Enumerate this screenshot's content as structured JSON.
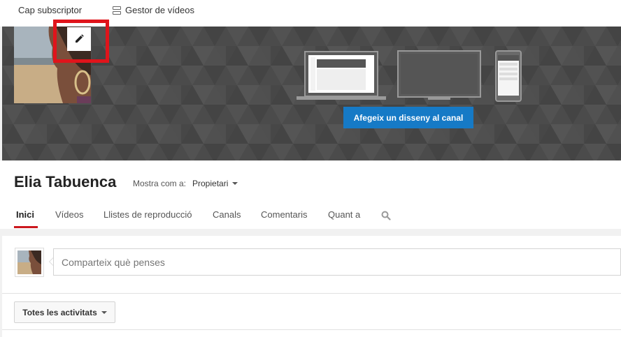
{
  "topbar": {
    "subscriber_count": "Cap subscriptor",
    "video_manager": "Gestor de vídeos"
  },
  "banner": {
    "cta_label": "Afegeix un disseny al canal"
  },
  "channel": {
    "name": "Elia Tabuenca",
    "view_as_label": "Mostra com a:",
    "view_as_value": "Propietari"
  },
  "tabs": [
    {
      "label": "Inici"
    },
    {
      "label": "Vídeos"
    },
    {
      "label": "Llistes de reproducció"
    },
    {
      "label": "Canals"
    },
    {
      "label": "Comentaris"
    },
    {
      "label": "Quant a"
    }
  ],
  "feed": {
    "share_placeholder": "Comparteix què penses",
    "filter_label": "Totes les activitats"
  },
  "colors": {
    "accent_red": "#cc181e",
    "highlight_red": "#e0141b",
    "button_blue": "#167ac6",
    "banner_gray": "#4a4a4a"
  }
}
